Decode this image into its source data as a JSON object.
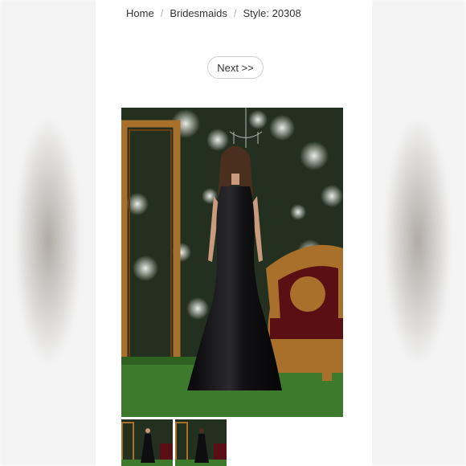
{
  "breadcrumb": {
    "items": [
      "Home",
      "Bridesmaids",
      "Style: 20308"
    ]
  },
  "pager": {
    "next_label": "Next >>"
  },
  "colors": {
    "gown": "#0e0e10",
    "frame_gold": "#a8702a",
    "velvet": "#5a0f14",
    "grass": "#3e7a2b",
    "greenery": "#2c3b26"
  },
  "icons": {
    "chandelier": "chandelier-icon"
  }
}
